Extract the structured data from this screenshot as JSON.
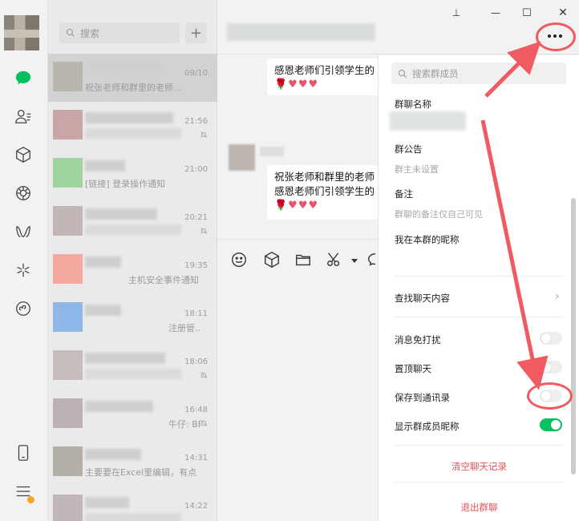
{
  "sidebar": {
    "icons": [
      "chat-icon",
      "contacts-icon",
      "favorites-icon",
      "moments-icon",
      "channels-icon",
      "discover-icon",
      "mini-programs-icon",
      "phone-icon",
      "menu-icon"
    ]
  },
  "chat_list": {
    "search_placeholder": "搜索",
    "add_label": "+",
    "items": [
      {
        "time": "09/10",
        "preview": "祝张老师和群里的老师..."
      },
      {
        "time": "21:56",
        "preview": ""
      },
      {
        "time": "21:00",
        "preview": "[链接] 登录操作通知"
      },
      {
        "time": "20:21",
        "preview": ""
      },
      {
        "time": "19:35",
        "preview": "主机安全事件通知"
      },
      {
        "time": "18:11",
        "preview": "注册管..."
      },
      {
        "time": "18:06",
        "preview": ""
      },
      {
        "time": "16:48",
        "preview": "牛仔: BF..."
      },
      {
        "time": "14:31",
        "preview": "主要要在Excel里编辑，有点..."
      },
      {
        "time": "14:22",
        "preview": ""
      }
    ]
  },
  "window": {
    "pin": "⊥",
    "minimize": "—",
    "maximize": "☐",
    "close": "✕"
  },
  "messages": [
    {
      "line1": "感恩老师们引领学生的",
      "emoji": "🌹♥♥♥"
    },
    {
      "line1": "祝张老师和群里的老师",
      "line2": "感恩老师们引领学生的",
      "emoji": "🌹♥♥♥"
    }
  ],
  "panel": {
    "search_placeholder": "搜索群成员",
    "group_name_label": "群聊名称",
    "announcement_label": "群公告",
    "announcement_value": "群主未设置",
    "remark_label": "备注",
    "remark_hint": "群聊的备注仅自己可见",
    "nickname_label": "我在本群的昵称",
    "find_history": "查找聊天内容",
    "chevron": "›",
    "mute_label": "消息免打扰",
    "pin_label": "置顶聊天",
    "save_contacts_label": "保存到通讯录",
    "show_nick_label": "显示群成员昵称",
    "toggles": {
      "mute": false,
      "pin": false,
      "save_contacts": false,
      "show_nick": true
    },
    "clear_history": "清空聊天记录",
    "leave_group": "退出群聊"
  },
  "colors": {
    "accent_green": "#07c160",
    "annotation_red": "#f05a61",
    "danger_red": "#e0545a"
  }
}
